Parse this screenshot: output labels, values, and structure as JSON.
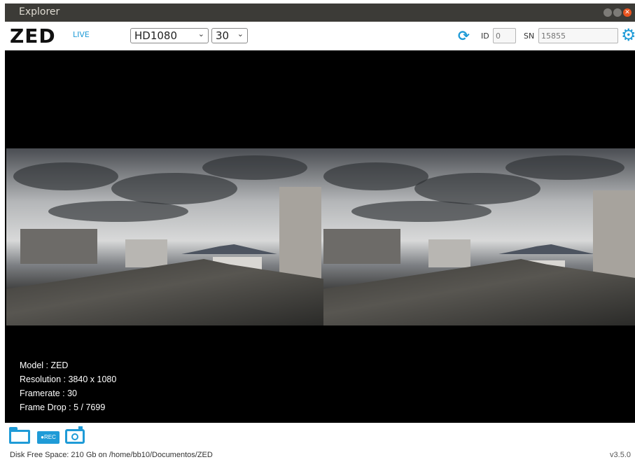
{
  "window": {
    "title": "Explorer"
  },
  "toolbar": {
    "logo": "ZED",
    "live_badge": "LIVE",
    "resolution_select": {
      "value": "HD1080"
    },
    "fps_select": {
      "value": "30"
    },
    "id_label": "ID",
    "id_placeholder": "0",
    "sn_label": "SN",
    "sn_placeholder": "15855",
    "icons": [
      "refresh-icon",
      "settings-gear-icon"
    ]
  },
  "viewer": {
    "info": {
      "model": "Model : ZED",
      "resolution": "Resolution : 3840 x 1080",
      "framerate": "Framerate : 30",
      "frame_drop": "Frame Drop : 5 / 7699"
    }
  },
  "bottom_bar": {
    "rec_label": "●REC",
    "icons": [
      "folder-icon",
      "record-icon",
      "snapshot-camera-icon"
    ],
    "disk_status": "Disk Free Space: 210 Gb  on /home/bb10/Documentos/ZED",
    "version": "v3.5.0"
  },
  "colors": {
    "accent": "#1f9bd7",
    "titlebar": "#3c3b37",
    "close_button": "#e95420"
  }
}
